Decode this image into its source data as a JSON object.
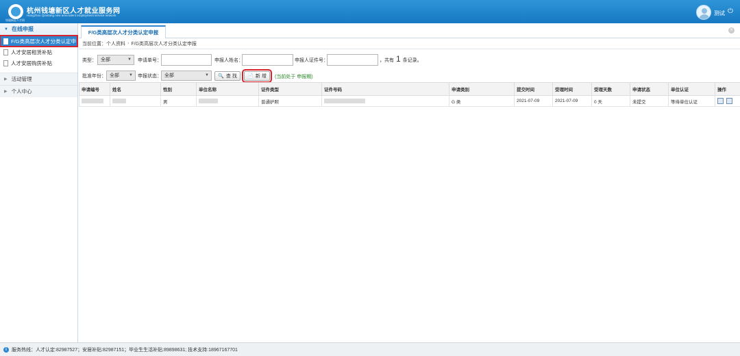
{
  "header": {
    "title": "杭州钱塘新区人才就业服务网",
    "subtitle": "Hangzhou Qiantang new area talent employment service network",
    "logo_caption": "钱塘新区人才网",
    "user": "测试",
    "power_glyph": "⏻"
  },
  "sidebar": {
    "section_title": "在线申报",
    "items": [
      {
        "label": "F/G类高层次人才分类认定申"
      },
      {
        "label": "人才安居租赁补贴"
      },
      {
        "label": "人才安居购房补贴"
      }
    ],
    "groups": [
      {
        "label": "活动管理"
      },
      {
        "label": "个人中心"
      }
    ]
  },
  "tab": {
    "label": "F/G类高层次人才分类认定申报"
  },
  "breadcrumb": {
    "prefix": "当前位置：",
    "parent": "个人资料",
    "separator": "›",
    "current": "F/G类高层次人才分类认定申报"
  },
  "filters": {
    "type_label": "类型：",
    "type_value": "全部",
    "app_no_label": "申请单号：",
    "applicant_label": "申报人姓名：",
    "id_label": "申报人证件号：",
    "count_prefix": "，共有",
    "count": "1",
    "count_suffix": "条记录。",
    "year_label": "批准年份：",
    "year_value": "全部",
    "status_label": "申报状态：",
    "status_value": "全部",
    "search_button": "查 找",
    "add_button": "新 增",
    "tip": "(当前处于 申报期)"
  },
  "table": {
    "headers": [
      "申请编号",
      "姓名",
      "性别",
      "单位名称",
      "证件类型",
      "证件号码",
      "申请类别",
      "提交时间",
      "受理时间",
      "受理天数",
      "申请状态",
      "单位认证",
      "操作"
    ],
    "rows": [
      {
        "gender": "男",
        "id_type": "普通护照",
        "category": "G 类",
        "submit_time": "2021-07-09",
        "accept_time": "2021-07-09",
        "days": "0 天",
        "status": "未提交",
        "company_cert": "等待单位认证"
      }
    ]
  },
  "footer": {
    "text": "服务热线：人才认定:82987527；安居补贴:82987151；毕业生生活补贴:89898631; 技术支持:18967167701"
  },
  "colors": {
    "brand": "#1678c2",
    "highlight": "#d8232a",
    "tip": "#2a8a2a"
  }
}
